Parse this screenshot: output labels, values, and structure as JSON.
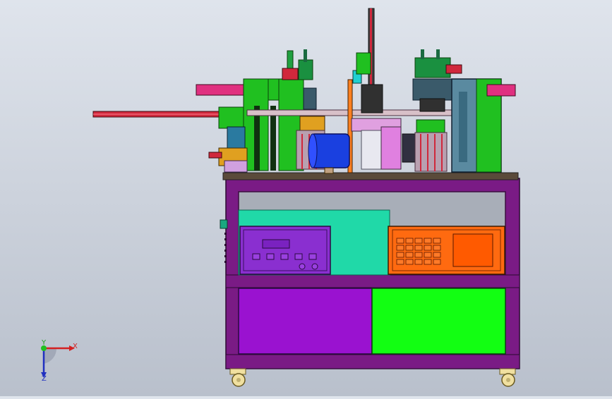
{
  "scene": {
    "description_icons": [
      "machine-assembly",
      "control-panel",
      "keypad-panel",
      "caster-wheel"
    ],
    "colors": {
      "background_top": "#dfe4ec",
      "background_bottom": "#b9c0cc",
      "frame_purple": "#7a1b85",
      "top_plate": "#5a4a3a",
      "teal_panel": "#20d9a8",
      "controller_purple": "#8a2fd0",
      "keypad_orange": "#ff6a10",
      "door_violet": "#9a12d0",
      "door_green": "#12ff12",
      "fixture_green": "#20c020",
      "cylinder_blue": "#1a40e0",
      "rail_red": "#d0283c"
    }
  },
  "triad": {
    "x_label": "X",
    "y_label": "Y",
    "z_label": "Z"
  }
}
